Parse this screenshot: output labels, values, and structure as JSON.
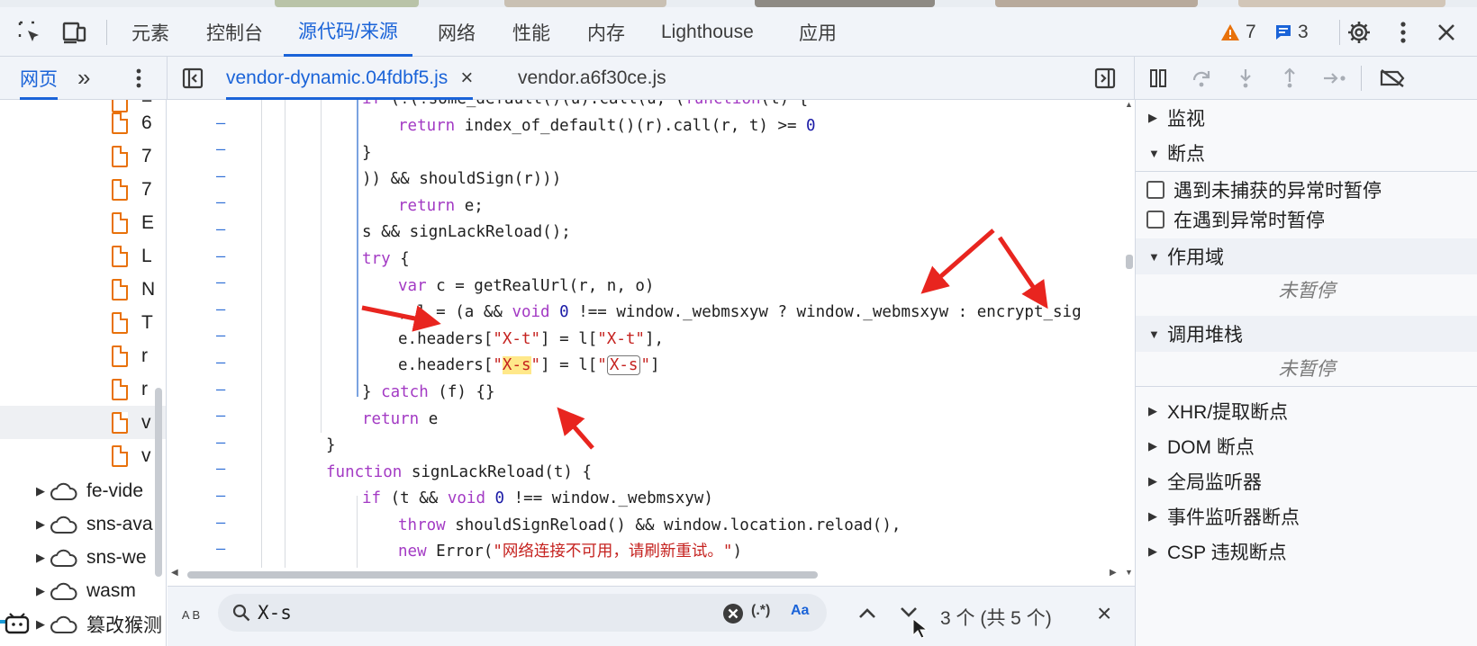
{
  "toolbar": {
    "tabs": [
      "元素",
      "控制台",
      "源代码/来源",
      "网络",
      "性能",
      "内存",
      "Lighthouse",
      "应用"
    ],
    "active_tab": "源代码/来源",
    "warnings_count": "7",
    "messages_count": "3"
  },
  "navigator": {
    "tab_label": "网页",
    "more": "»",
    "files": [
      "6",
      "7",
      "7",
      "E",
      "L",
      "N",
      "T",
      "r",
      "r",
      "v",
      "v"
    ],
    "domains": [
      "fe-vide",
      "sns-ava",
      "sns-we",
      "wasm",
      "篡改猴测"
    ]
  },
  "editor": {
    "tabs": [
      {
        "label": "vendor-dynamic.04fdbf5.js",
        "close": "×"
      },
      {
        "label": "vendor.a6f30ce.js"
      }
    ]
  },
  "code": {
    "lines": [
      "if (!(!some_default()(u).call(u, (function(t) {",
      "return index_of_default()(r).call(r, t) >= 0",
      "}",
      ")) && shouldSign(r)))",
      "return e;",
      "s && signLackReload();",
      "try {",
      "var c = getRealUrl(r, n, o)",
      ", l = (a && void 0 !== window._webmsxyw ? window._webmsxyw : encrypt_sig",
      "e.headers[\"X-t\"] = l[\"X-t\"],",
      "e.headers[\"X-s\"] = l[\"X-s\"]",
      "} catch (f) {}",
      "return e",
      "}",
      "function signLackReload(t) {",
      "if (t && void 0 !== window._webmsxyw)",
      "throw shouldSignReload() && window.location.reload(),",
      "new Error(\"网络连接不可用，请刷新重试。\")"
    ]
  },
  "search": {
    "query": "X-s",
    "regex_label": "(.*)",
    "case_label": "Aa",
    "ab_label": "A B",
    "result_count": "3 个 (共 5 个)",
    "close": "×"
  },
  "sidebar": {
    "watch": "监视",
    "breakpoints": "断点",
    "pause_uncaught": "遇到未捕获的异常时暂停",
    "pause_caught": "在遇到异常时暂停",
    "scope": "作用域",
    "not_paused_1": "未暂停",
    "call_stack": "调用堆栈",
    "not_paused_2": "未暂停",
    "xhr": "XHR/提取断点",
    "dom": "DOM 断点",
    "global": "全局监听器",
    "event": "事件监听器断点",
    "csp": "CSP 违规断点"
  },
  "colors": {
    "accent": "#1a63d8",
    "warning": "#e8710a",
    "arrow": "#e8251f",
    "highlight": "#ffe88a"
  }
}
